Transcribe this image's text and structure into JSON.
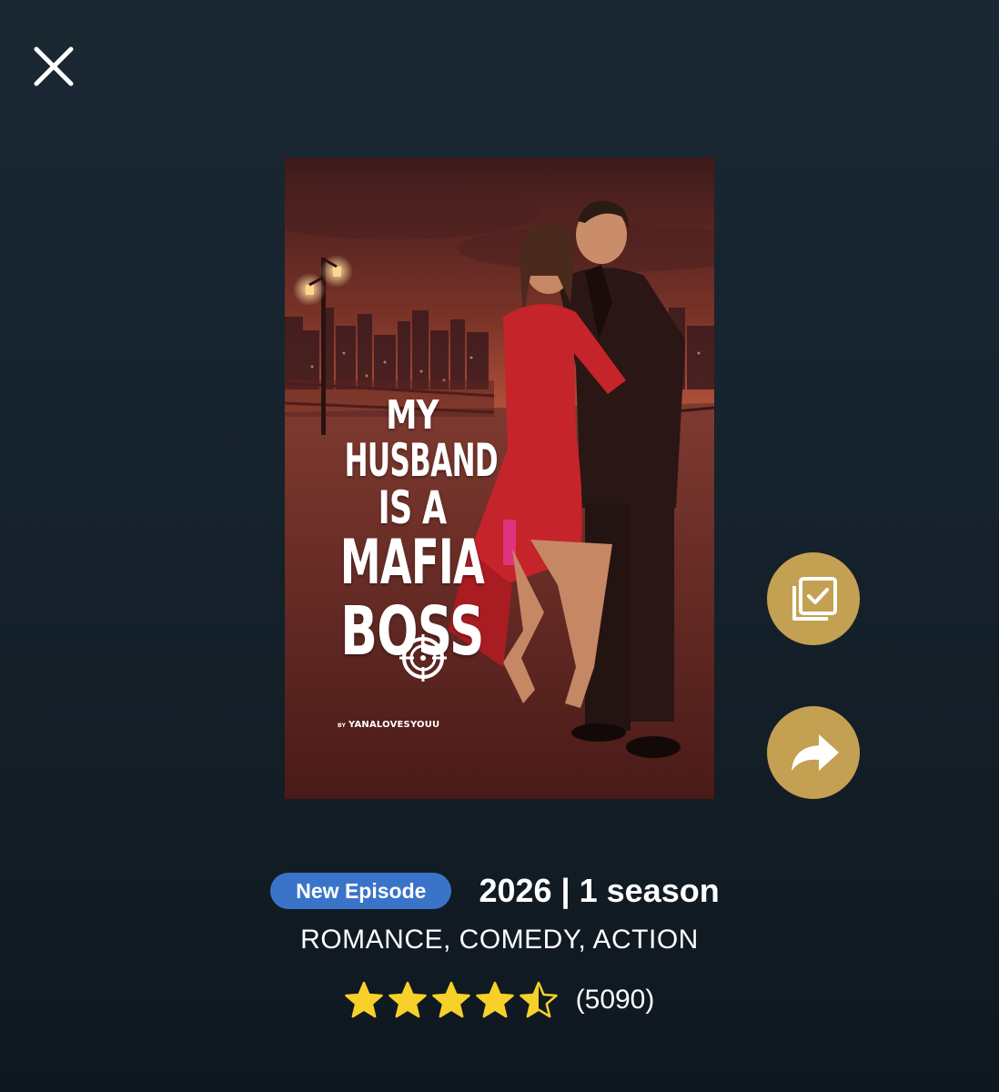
{
  "close": {
    "icon": "close-icon"
  },
  "poster": {
    "title_lines": [
      "MY",
      "HUSBAND",
      "IS A",
      "MAFIA",
      "BOSS"
    ],
    "byline_prefix": "BY",
    "byline_author": "YANALOVESYOUU"
  },
  "actions": {
    "my_list_icon": "checked-list-icon",
    "share_icon": "share-arrow-icon",
    "accent_color": "#c4a052"
  },
  "meta": {
    "badge": "New Episode",
    "badge_color": "#3a74c9",
    "year_season": "2026 | 1 season",
    "genres": "ROMANCE, COMEDY, ACTION"
  },
  "rating": {
    "stars": 4.5,
    "max_stars": 5,
    "count": "(5090)",
    "star_color": "#f7d12a"
  }
}
